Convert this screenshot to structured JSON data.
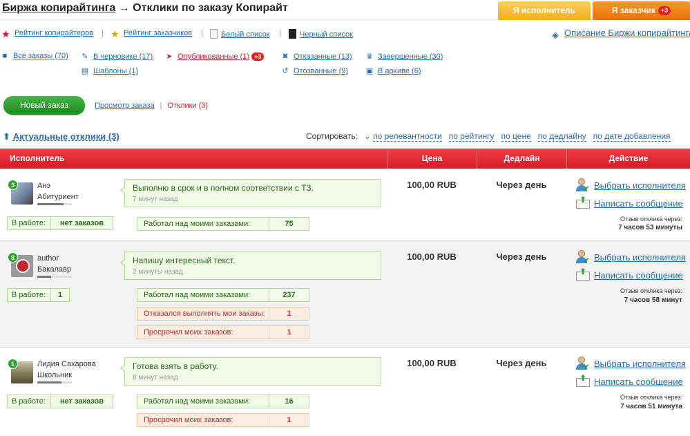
{
  "header": {
    "breadcrumb_root": "Биржа копирайтинга",
    "arrow": "→",
    "page_title": "Отклики по заказу Копирайт",
    "role_executor": "Я исполнитель",
    "role_customer": "Я заказчик",
    "role_customer_badge": "+3"
  },
  "toplinks": {
    "rating_copywriters": "Рейтинг копирайтеров",
    "rating_customers": "Рейтинг заказчиков",
    "whitelist": "Белый список",
    "blacklist": "Черный список",
    "exchange_description": "Описание Биржи копирайтинга",
    "separator": "|"
  },
  "statuses": {
    "all": "Все заказы (70)",
    "draft": "В черновике (17)",
    "published": "Опубликованные (1)",
    "published_badge": "+3",
    "rejected": "Отказанные (13)",
    "completed": "Завершенные (30)",
    "templates": "Шаблоны (1)",
    "recalled": "Отозванные (9)",
    "archive": "В архиве (6)"
  },
  "actions": {
    "new_order": "Новый заказ",
    "view_order": "Просмотр заказа",
    "responses": "Отклики (3)",
    "separator": "|"
  },
  "section": {
    "title": "Актуальные отклики (3)",
    "sort_label": "Сортировать:",
    "sort_options": [
      "по релевантности",
      "по рейтингу",
      "по цене",
      "по дедлайну",
      "по дате добавления"
    ]
  },
  "table": {
    "headers": [
      "Исполнитель",
      "Цена",
      "Дедлайн",
      "Действие"
    ],
    "choose_label": "Выбрать исполнителя",
    "message_label": "Написать сообщение",
    "review_label": "Отзыв отклика через:",
    "rows": [
      {
        "level": "3",
        "name": "Анэ",
        "rank": "Абитуриент",
        "rank_progress": 0.75,
        "message": "Выполню в срок и в полном соответствии с ТЗ.",
        "ago": "7 минут назад",
        "in_work_label": "В работе:",
        "in_work_value": "нет заказов",
        "stats": [
          {
            "label": "Работал над моими заказами:",
            "value": "75",
            "kind": "g"
          }
        ],
        "price": "100,00 RUB",
        "deadline": "Через день",
        "review_time": "7 часов 53 минуты",
        "avatar_color": "#7f9bb5"
      },
      {
        "level": "8",
        "name": "author",
        "rank": "Бакалавр",
        "rank_progress": 0.4,
        "message": "Напишу интересный текст.",
        "ago": "2 минуты назад",
        "in_work_label": "В работе:",
        "in_work_value": "1",
        "stats": [
          {
            "label": "Работал над моими заказами:",
            "value": "237",
            "kind": "g"
          },
          {
            "label": "Отказался выполнять мои заказы:",
            "value": "1",
            "kind": "r"
          },
          {
            "label": "Просрочил моих заказов:",
            "value": "1",
            "kind": "r"
          }
        ],
        "price": "100,00 RUB",
        "deadline": "Через день",
        "review_time": "7 часов 58 минут",
        "avatar_color": "#c0262b"
      },
      {
        "level": "1",
        "name": "Лидия Сахарова",
        "rank": "Школьник",
        "rank_progress": 0.7,
        "message": "Готова взять в работу.",
        "ago": "8 минут назад",
        "in_work_label": "В работе:",
        "in_work_value": "нет заказов",
        "stats": [
          {
            "label": "Работал над моими заказами:",
            "value": "16",
            "kind": "g"
          },
          {
            "label": "Просрочил моих заказов:",
            "value": "1",
            "kind": "r"
          }
        ],
        "price": "100,00 RUB",
        "deadline": "Через день",
        "review_time": "7 часов 51 минута",
        "avatar_color": "#8a8f6a"
      }
    ]
  },
  "colors": {
    "accent_red": "#d81924",
    "link_blue": "#2a6aa6",
    "green_button": "#1e8a1f",
    "tab_yellow": "#f4ad1f",
    "tab_orange": "#ec6f08"
  }
}
